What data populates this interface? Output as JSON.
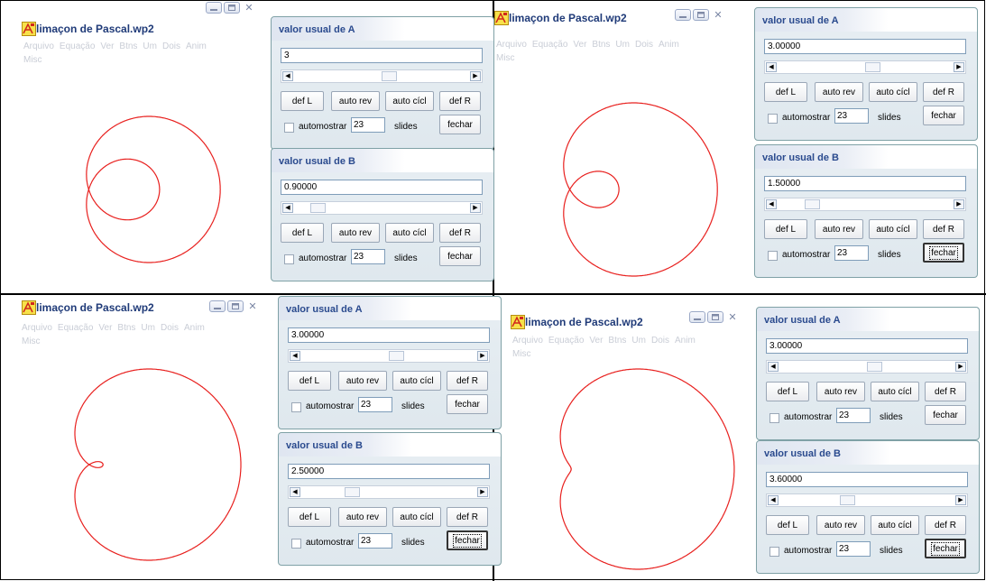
{
  "window": {
    "title": "limaçon de Pascal.wp2",
    "menu": [
      "Arquivo",
      "Equação",
      "Ver",
      "Btns",
      "Um",
      "Dois",
      "Anim"
    ],
    "menu2": "Misc"
  },
  "dialog_a_title": "valor usual de A",
  "dialog_b_title": "valor usual de B",
  "buttons": {
    "def_l": "def L",
    "auto_rev": "auto rev",
    "auto_cicl": "auto cícl",
    "def_r": "def R",
    "fechar": "fechar",
    "automostrar": "automostrar",
    "slides": "slides",
    "slides_count": "23"
  },
  "panels": [
    {
      "a_value": "3",
      "a_slider": 0.55,
      "b_value": "0.90000",
      "b_slider": 0.1,
      "b_fechar_focused": false,
      "curve_b": 0.9
    },
    {
      "a_value": "3.00000",
      "a_slider": 0.55,
      "b_value": "1.50000",
      "b_slider": 0.17,
      "b_fechar_focused": true,
      "curve_b": 1.5
    },
    {
      "a_value": "3.00000",
      "a_slider": 0.55,
      "b_value": "2.50000",
      "b_slider": 0.27,
      "b_fechar_focused": true,
      "curve_b": 2.5
    },
    {
      "a_value": "3.00000",
      "a_slider": 0.55,
      "b_value": "3.60000",
      "b_slider": 0.38,
      "b_fechar_focused": true,
      "curve_b": 3.6
    }
  ],
  "colors": {
    "curve": "#e8201e",
    "title": "#1f3a78"
  }
}
